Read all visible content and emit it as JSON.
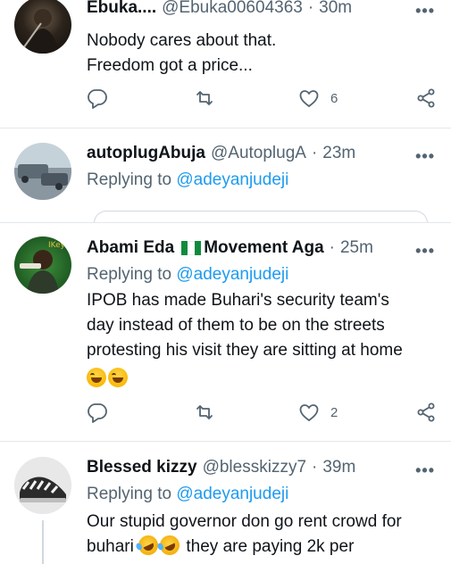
{
  "tweets": [
    {
      "name": "Ebuka....",
      "handle": "@Ebuka00604363",
      "time": "30m",
      "text_lines": [
        "Nobody cares about that.",
        "Freedom got a price..."
      ],
      "reply_count": "",
      "retweet_count": "",
      "like_count": "6"
    },
    {
      "name": "autoplugAbuja",
      "handle": "@AutoplugA",
      "time": "23m",
      "replying_label": "Replying to",
      "replying_handle": "@adeyanjudeji"
    },
    {
      "name": "Abami Eda",
      "name_suffix": "Movement Aga",
      "time": "25m",
      "replying_label": "Replying to",
      "replying_handle": "@adeyanjudeji",
      "text_lines": [
        "IPOB has made Buhari's security team's",
        "day instead of them to be on the streets",
        "protesting his visit they are sitting at home"
      ],
      "emoji": "laughing",
      "like_count": "2"
    },
    {
      "name": "Blessed kizzy",
      "handle": "@blesskizzy7",
      "time": "39m",
      "replying_label": "Replying to",
      "replying_handle": "@adeyanjudeji",
      "text_line_1": "Our stupid governor don go rent crowd for",
      "text_line_2a": "buhari",
      "text_line_2b": "they are paying 2k per"
    }
  ],
  "separator": "·",
  "more_glyph": "•••",
  "icons": [
    "reply-icon",
    "retweet-icon",
    "like-icon",
    "share-icon",
    "more-icon"
  ],
  "colors": {
    "link": "#1d9bf0",
    "secondary": "#536471",
    "divider": "#e3e8ec"
  }
}
